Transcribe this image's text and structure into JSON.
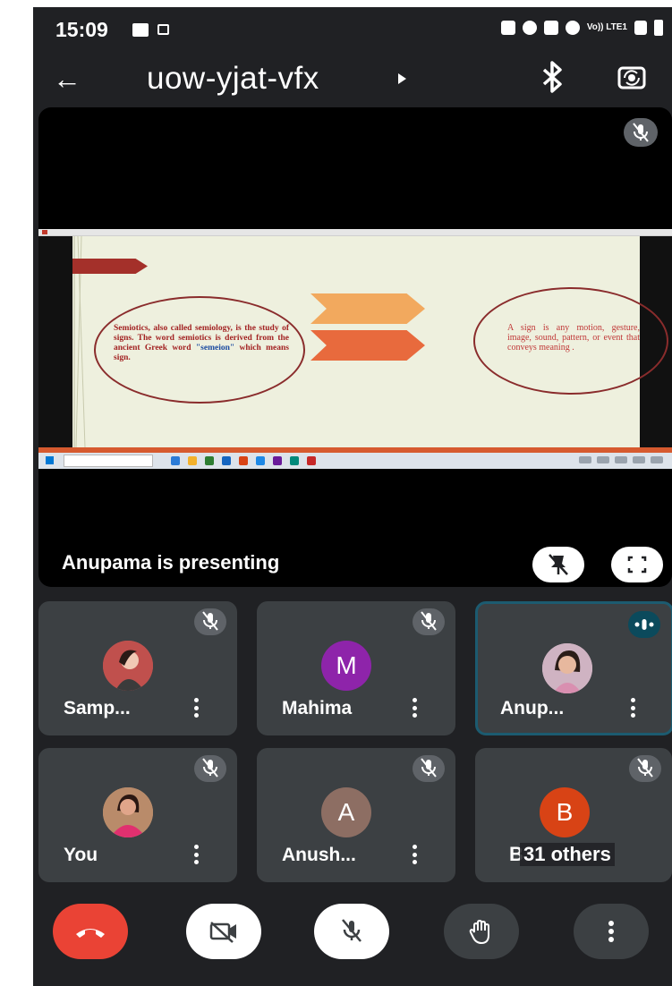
{
  "status_bar": {
    "time": "15:09",
    "network": "Vo)) LTE1"
  },
  "top_bar": {
    "meeting_code": "uow-yjat-vfx"
  },
  "stage": {
    "presenter_text": "Anupama is presenting",
    "slide": {
      "left_circle_text_a": "Semiotics, also called semiology, is the study of signs. The word semiotics is derived from the ancient Greek word",
      "left_circle_keyword": "\"semeion\"",
      "left_circle_text_b": "which means sign.",
      "right_circle_text": "A sign is any motion, gesture, image, sound, pattern, or event that conveys meaning ."
    }
  },
  "tiles": [
    {
      "name": "Samp...",
      "muted": true
    },
    {
      "name": "Mahima",
      "initial": "M",
      "avatar_color": "#8e24aa",
      "muted": true
    },
    {
      "name": "Anup...",
      "speaking": true
    },
    {
      "name": "You",
      "muted": true
    },
    {
      "name": "Anush...",
      "initial": "A",
      "avatar_color": "#8d6e63",
      "muted": true
    },
    {
      "name": "31 others",
      "initial": "B",
      "avatar_color": "#d84315",
      "muted": true
    }
  ],
  "colors": {
    "background": "#202124",
    "tile": "#3c4043",
    "end_call": "#ea4335",
    "speaking_border": "#1c5b70"
  }
}
